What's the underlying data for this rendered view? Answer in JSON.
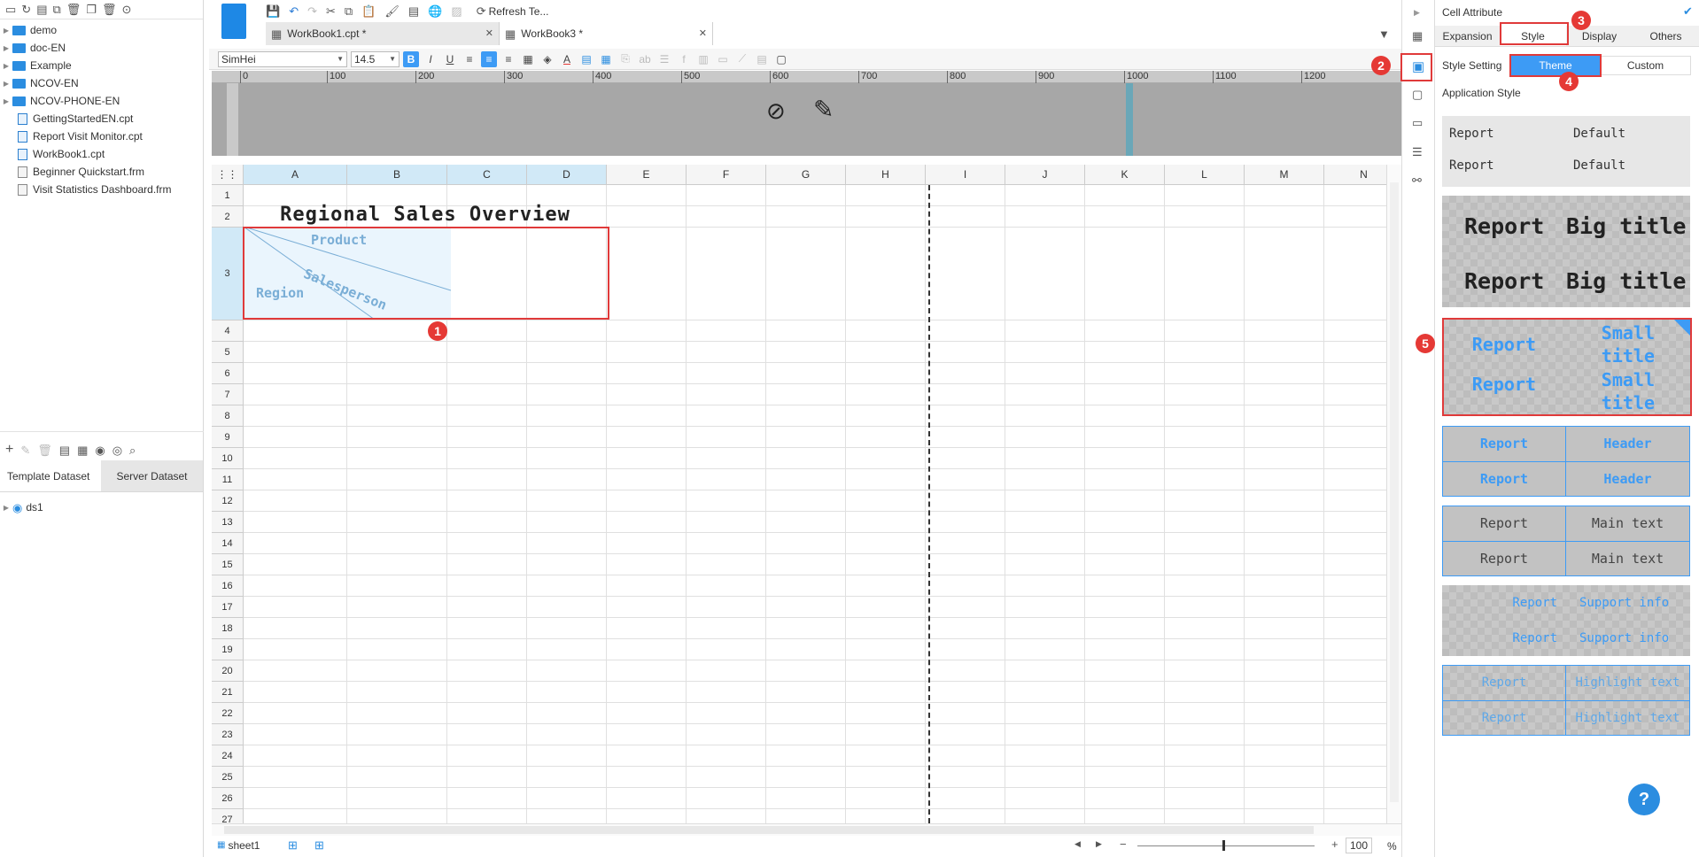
{
  "left_tree": {
    "folders": [
      "demo",
      "doc-EN",
      "Example",
      "NCOV-EN",
      "NCOV-PHONE-EN"
    ],
    "files": [
      {
        "name": "GettingStartedEN.cpt",
        "type": "cpt"
      },
      {
        "name": "Report Visit Monitor.cpt",
        "type": "cpt"
      },
      {
        "name": "WorkBook1.cpt",
        "type": "cpt"
      },
      {
        "name": "Beginner Quickstart.frm",
        "type": "frm"
      },
      {
        "name": "Visit Statistics Dashboard.frm",
        "type": "frm"
      }
    ]
  },
  "dataset_tabs": {
    "template": "Template Dataset",
    "server": "Server Dataset"
  },
  "datasets": [
    "ds1"
  ],
  "toolbar": {
    "refresh_label": "Refresh Te..."
  },
  "file_tabs": [
    "WorkBook1.cpt *",
    "WorkBook3 *"
  ],
  "format": {
    "font": "SimHei",
    "size": "14.5"
  },
  "ruler_ticks": [
    "0",
    "100",
    "200",
    "300",
    "400",
    "500",
    "600",
    "700",
    "800",
    "900",
    "1000",
    "1100",
    "1200"
  ],
  "columns": [
    "A",
    "B",
    "C",
    "D",
    "E",
    "F",
    "G",
    "H",
    "I",
    "J",
    "K",
    "L",
    "M",
    "N"
  ],
  "rows": [
    "1",
    "2",
    "3",
    "4",
    "5",
    "6",
    "7",
    "8",
    "9",
    "10",
    "11",
    "12",
    "13",
    "14",
    "15",
    "16",
    "17",
    "18",
    "19",
    "20",
    "21",
    "22",
    "23",
    "24",
    "25",
    "26",
    "27"
  ],
  "sheet": {
    "title": "Regional Sales Overview",
    "slash_labels": {
      "top": "Product",
      "mid": "Salesperson",
      "bottom": "Region"
    }
  },
  "bottom": {
    "sheet_tab": "sheet1",
    "zoom": "100",
    "zoom_unit": "%"
  },
  "right_panel": {
    "title": "Cell Attribute",
    "tabs": [
      "Expansion",
      "Style",
      "Display",
      "Others"
    ],
    "style_setting_label": "Style Setting",
    "style_options": [
      "Theme",
      "Custom"
    ],
    "application_style_label": "Application Style",
    "styles": [
      {
        "left": "Report",
        "right": "Default"
      },
      {
        "left": "Report",
        "right": "Big title"
      },
      {
        "left": "Report",
        "right": "Small title"
      },
      {
        "left": "Report",
        "right": "Header"
      },
      {
        "left": "Report",
        "right": "Main text"
      },
      {
        "left": "Report",
        "right": "Support info"
      },
      {
        "left": "Report",
        "right": "Highlight text"
      }
    ],
    "help": "?"
  },
  "badges": [
    "1",
    "2",
    "3",
    "4",
    "5"
  ],
  "colors": {
    "accent": "#2b8de0",
    "selection": "#d1e9f7",
    "highlight_red": "#e03a3a",
    "theme_btn": "#3d9bf5"
  }
}
